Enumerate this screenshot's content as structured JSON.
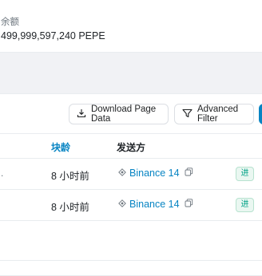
{
  "balance": {
    "label": "余额",
    "value": "499,999,597,240 PEPE"
  },
  "toolbar": {
    "download_label": "Download Page Data",
    "filter_label": "Advanced Filter"
  },
  "table": {
    "columns": {
      "age": "块龄",
      "from": "发送方"
    },
    "rows": [
      {
        "lead": ".",
        "age": "8 小时前",
        "from": "Binance 14",
        "direction": "进"
      },
      {
        "lead": "",
        "age": "8 小时前",
        "from": "Binance 14",
        "direction": "进"
      }
    ]
  },
  "colors": {
    "accent": "#0784c3",
    "badge_text": "#00a186",
    "badge_bg": "#eaf7f1"
  },
  "icons": [
    "download-icon",
    "filter-icon",
    "binance-icon",
    "copy-icon"
  ]
}
